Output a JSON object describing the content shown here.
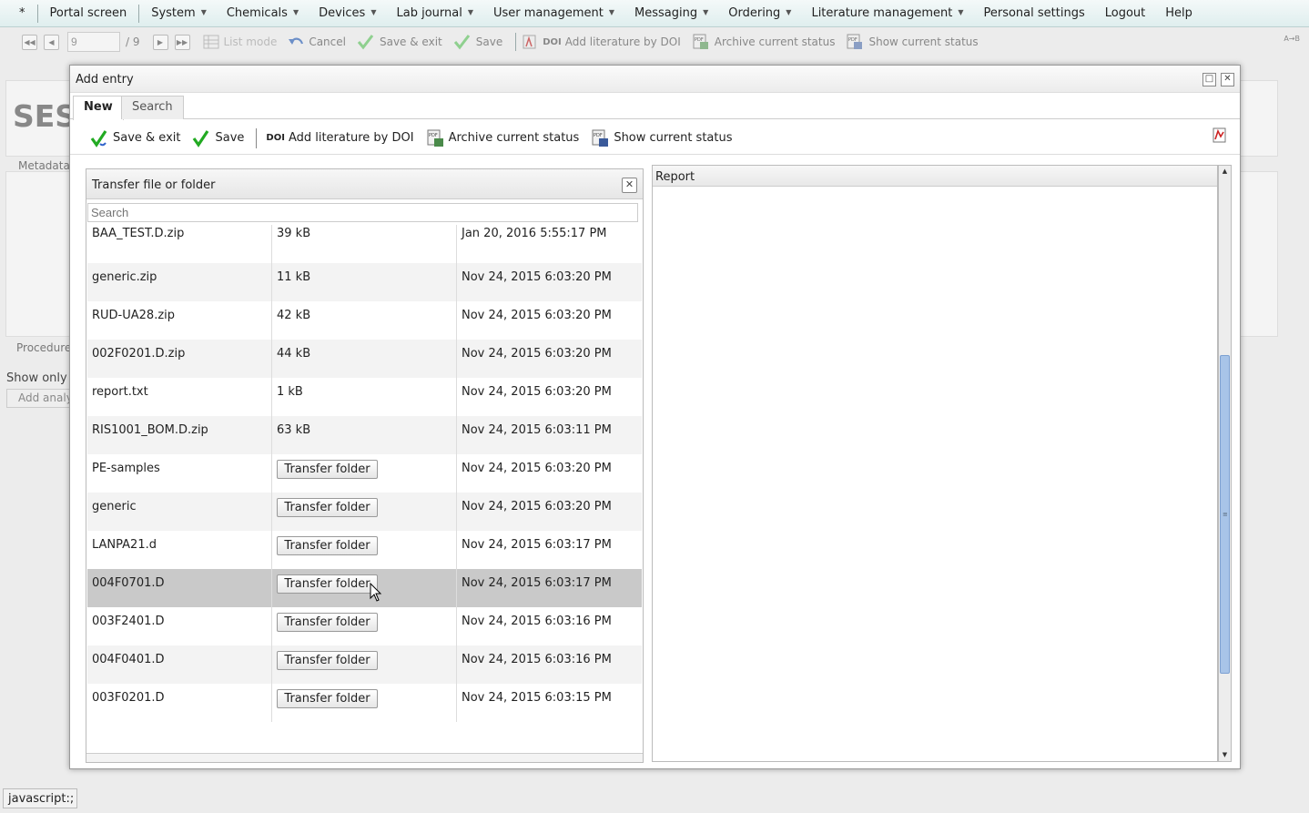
{
  "menubar": {
    "star": "*",
    "items": [
      {
        "label": "Portal screen",
        "dropdown": false
      },
      {
        "label": "System",
        "dropdown": true
      },
      {
        "label": "Chemicals",
        "dropdown": true
      },
      {
        "label": "Devices",
        "dropdown": true
      },
      {
        "label": "Lab journal",
        "dropdown": true
      },
      {
        "label": "User management",
        "dropdown": true
      },
      {
        "label": "Messaging",
        "dropdown": true
      },
      {
        "label": "Ordering",
        "dropdown": true
      },
      {
        "label": "Literature management",
        "dropdown": true
      },
      {
        "label": "Personal settings",
        "dropdown": false
      },
      {
        "label": "Logout",
        "dropdown": false
      },
      {
        "label": "Help",
        "dropdown": false
      }
    ]
  },
  "bg_toolbar": {
    "page_value": "9",
    "page_total": "/ 9",
    "list_mode": "List mode",
    "cancel": "Cancel",
    "save_exit": "Save & exit",
    "save": "Save",
    "doi_prefix": "DOI",
    "add_doi": "Add literature by DOI",
    "archive": "Archive current status",
    "show_status": "Show current status",
    "sort_icon_text": "A→B"
  },
  "bg_page": {
    "big_title": "SES",
    "metadata": "Metadata",
    "procedure": "Procedure",
    "show_only": "Show only c",
    "add_analysis": "Add analys"
  },
  "dialog": {
    "title": "Add entry",
    "tabs": [
      "New",
      "Search"
    ],
    "toolbar": {
      "save_exit": "Save & exit",
      "save": "Save",
      "doi_prefix": "DOI",
      "add_doi": "Add literature by DOI",
      "archive": "Archive current status",
      "show_status": "Show current status"
    },
    "transfer": {
      "title": "Transfer file or folder",
      "search_placeholder": "Search",
      "button_label": "Transfer folder",
      "rows": [
        {
          "name": "BAA_TEST.D.zip",
          "size": "39 kB",
          "date": "Jan 20, 2016 5:55:17 PM",
          "folder": false
        },
        {
          "name": "generic.zip",
          "size": "11 kB",
          "date": "Nov 24, 2015 6:03:20 PM",
          "folder": false
        },
        {
          "name": "RUD-UA28.zip",
          "size": "42 kB",
          "date": "Nov 24, 2015 6:03:20 PM",
          "folder": false
        },
        {
          "name": "002F0201.D.zip",
          "size": "44 kB",
          "date": "Nov 24, 2015 6:03:20 PM",
          "folder": false
        },
        {
          "name": "report.txt",
          "size": "1 kB",
          "date": "Nov 24, 2015 6:03:20 PM",
          "folder": false
        },
        {
          "name": "RIS1001_BOM.D.zip",
          "size": "63 kB",
          "date": "Nov 24, 2015 6:03:11 PM",
          "folder": false
        },
        {
          "name": "PE-samples",
          "size": "",
          "date": "Nov 24, 2015 6:03:20 PM",
          "folder": true
        },
        {
          "name": "generic",
          "size": "",
          "date": "Nov 24, 2015 6:03:20 PM",
          "folder": true
        },
        {
          "name": "LANPA21.d",
          "size": "",
          "date": "Nov 24, 2015 6:03:17 PM",
          "folder": true
        },
        {
          "name": "004F0701.D",
          "size": "",
          "date": "Nov 24, 2015 6:03:17 PM",
          "folder": true,
          "selected": true
        },
        {
          "name": "003F2401.D",
          "size": "",
          "date": "Nov 24, 2015 6:03:16 PM",
          "folder": true
        },
        {
          "name": "004F0401.D",
          "size": "",
          "date": "Nov 24, 2015 6:03:16 PM",
          "folder": true
        },
        {
          "name": "003F0201.D",
          "size": "",
          "date": "Nov 24, 2015 6:03:15 PM",
          "folder": true
        }
      ]
    },
    "report": {
      "title": "Report"
    }
  },
  "statusbar": {
    "text": "javascript:;"
  },
  "colors": {
    "check": "#22aa22",
    "scroll_thumb": "#a8c4e8",
    "selected_row": "#c9c9c9"
  }
}
